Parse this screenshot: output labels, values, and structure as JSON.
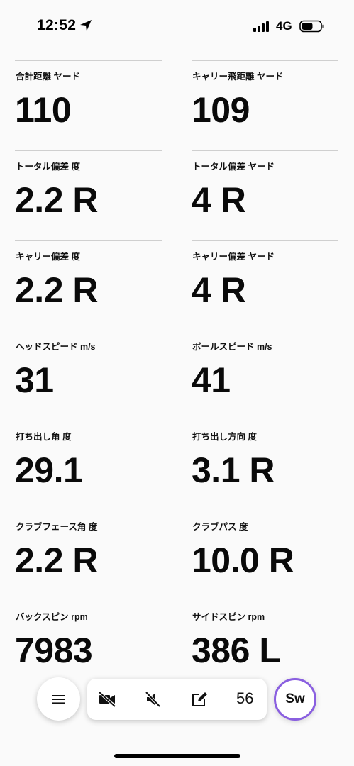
{
  "status_bar": {
    "time": "12:52",
    "network": "4G"
  },
  "metrics": [
    {
      "label": "合計距離 ヤード",
      "value": "110"
    },
    {
      "label": "キャリー飛距離 ヤード",
      "value": "109"
    },
    {
      "label": "トータル偏差 度",
      "value": "2.2 R"
    },
    {
      "label": "トータル偏差 ヤード",
      "value": "4 R"
    },
    {
      "label": "キャリー偏差 度",
      "value": "2.2 R"
    },
    {
      "label": "キャリー偏差 ヤード",
      "value": "4 R"
    },
    {
      "label": "ヘッドスピード m/s",
      "value": "31"
    },
    {
      "label": "ボールスピード m/s",
      "value": "41"
    },
    {
      "label": "打ち出し角 度",
      "value": "29.1"
    },
    {
      "label": "打ち出し方向 度",
      "value": "3.1 R"
    },
    {
      "label": "クラブフェース角 度",
      "value": "2.2 R"
    },
    {
      "label": "クラブパス 度",
      "value": "10.0 R"
    },
    {
      "label": "バックスピン rpm",
      "value": "7983"
    },
    {
      "label": "サイドスピン rpm",
      "value": "386 L"
    }
  ],
  "toolbar": {
    "shot_count": "56",
    "club": "Sw",
    "club_ring_color": "#8a5fe0",
    "icons": [
      "menu-icon",
      "video-off-icon",
      "sound-off-icon",
      "edit-icon"
    ]
  }
}
